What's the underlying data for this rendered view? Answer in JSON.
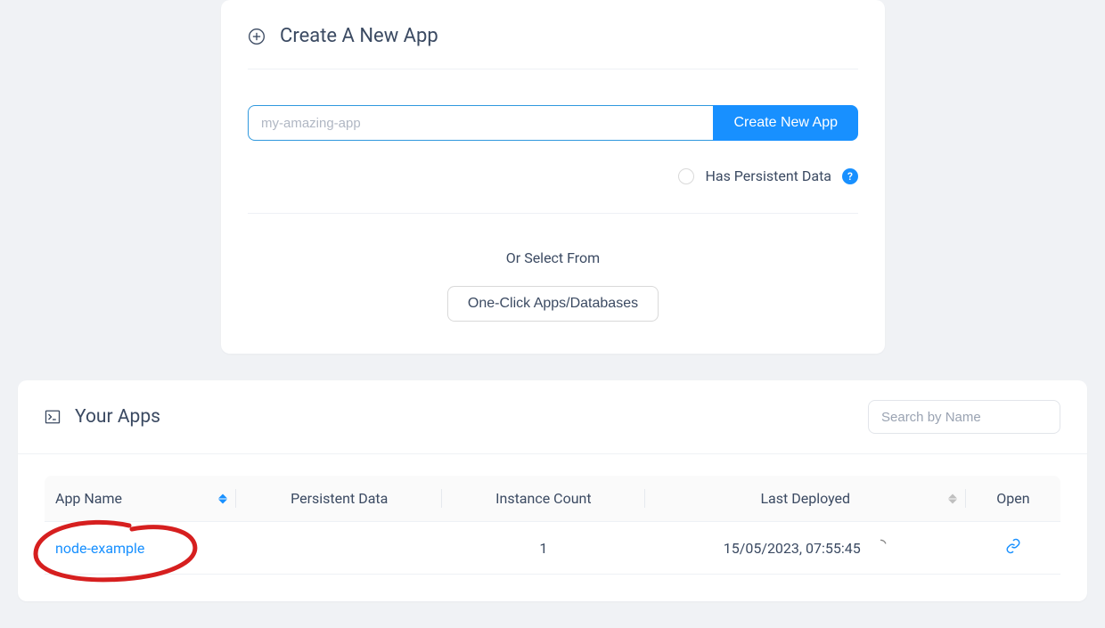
{
  "create": {
    "title": "Create A New App",
    "input_placeholder": "my-amazing-app",
    "button_label": "Create New App",
    "persistent_label": "Has Persistent Data",
    "help_symbol": "?",
    "or_select": "Or Select From",
    "oneclick_label": "One-Click Apps/Databases"
  },
  "apps": {
    "title": "Your Apps",
    "search_placeholder": "Search by Name",
    "columns": {
      "app_name": "App Name",
      "persistent_data": "Persistent Data",
      "instance_count": "Instance Count",
      "last_deployed": "Last Deployed",
      "open": "Open"
    },
    "rows": [
      {
        "name": "node-example",
        "persistent": "",
        "instances": "1",
        "deployed": "15/05/2023, 07:55:45"
      }
    ]
  }
}
